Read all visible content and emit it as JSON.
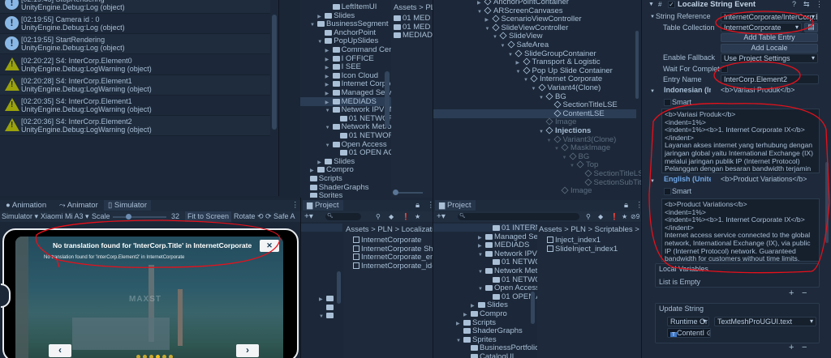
{
  "console": {
    "entries": [
      {
        "type": "info",
        "line1": "[02:19:45] StopRendering",
        "line2": "UnityEngine.Debug:Log (object)"
      },
      {
        "type": "info",
        "line1": "[02:19:55] Camera id : 0",
        "line2": "UnityEngine.Debug:Log (object)"
      },
      {
        "type": "info",
        "line1": "[02:19:55] StartRendering",
        "line2": "UnityEngine.Debug:Log (object)"
      },
      {
        "type": "warn",
        "line1": "[02:20:22] S4: InterCorp.Element0",
        "line2": "UnityEngine.Debug:LogWarning (object)"
      },
      {
        "type": "warn",
        "line1": "[02:20:28] S4: InterCorp.Element1",
        "line2": "UnityEngine.Debug:LogWarning (object)"
      },
      {
        "type": "warn",
        "line1": "[02:20:35] S4: InterCorp.Element1",
        "line2": "UnityEngine.Debug:LogWarning (object)"
      },
      {
        "type": "warn",
        "line1": "[02:20:36] S4: InterCorp.Element2",
        "line2": "UnityEngine.Debug:LogWarning (object)"
      }
    ]
  },
  "project_top": {
    "tree": [
      {
        "d": 2,
        "a": "",
        "n": "LeftItemUI"
      },
      {
        "d": 1,
        "a": "▶",
        "n": "Slides"
      },
      {
        "d": 0,
        "a": "▼",
        "n": "BusinessSegment",
        "open": true
      },
      {
        "d": 1,
        "a": "",
        "n": "AnchorPoint"
      },
      {
        "d": 1,
        "a": "▼",
        "n": "PopUpSlides",
        "open": true
      },
      {
        "d": 2,
        "a": "▶",
        "n": "Command Cente"
      },
      {
        "d": 2,
        "a": "▶",
        "n": "I OFFICE"
      },
      {
        "d": 2,
        "a": "▶",
        "n": "I SEE"
      },
      {
        "d": 2,
        "a": "▶",
        "n": "Icon Cloud"
      },
      {
        "d": 2,
        "a": "▶",
        "n": "Internet Corpora"
      },
      {
        "d": 2,
        "a": "▶",
        "n": "Managed Servic"
      },
      {
        "d": 2,
        "a": "▶",
        "n": "MEDIADS",
        "sel": true
      },
      {
        "d": 2,
        "a": "▼",
        "n": "Network IPVPN",
        "open": true
      },
      {
        "d": 3,
        "a": "",
        "n": "01 NETWORK"
      },
      {
        "d": 2,
        "a": "▼",
        "n": "Network Metron",
        "open": true
      },
      {
        "d": 3,
        "a": "",
        "n": "01 NETWORK"
      },
      {
        "d": 2,
        "a": "▼",
        "n": "Open Access",
        "open": true
      },
      {
        "d": 3,
        "a": "",
        "n": "01 OPEN ACC"
      },
      {
        "d": 1,
        "a": "▶",
        "n": "Slides"
      },
      {
        "d": 0,
        "a": "▶",
        "n": "Compro"
      },
      {
        "d": -1,
        "a": "",
        "n": "Scripts"
      },
      {
        "d": -1,
        "a": "",
        "n": "ShaderGraphs"
      },
      {
        "d": -1,
        "a": "",
        "n": "Sprites",
        "open": true
      }
    ],
    "breadcrumb": "Assets > PL",
    "assets": [
      "01 MED",
      "01 MED",
      "MEDIAD"
    ]
  },
  "hierarchy": {
    "items": [
      {
        "d": 0,
        "a": "▶",
        "n": "AnchorPointContainer"
      },
      {
        "d": 0,
        "a": "▼",
        "n": "ARScreenCanvases"
      },
      {
        "d": 1,
        "a": "▶",
        "n": "ScenarioViewController"
      },
      {
        "d": 1,
        "a": "▼",
        "n": "SlideViewController"
      },
      {
        "d": 2,
        "a": "▼",
        "n": "SlideView"
      },
      {
        "d": 3,
        "a": "▼",
        "n": "SafeArea"
      },
      {
        "d": 4,
        "a": "▼",
        "n": "SlideGroupContainer"
      },
      {
        "d": 5,
        "a": "▶",
        "n": "Transport & Logistic"
      },
      {
        "d": 5,
        "a": "▼",
        "n": "Pop Up Slide Container"
      },
      {
        "d": 6,
        "a": "▼",
        "n": "Internet Corporate"
      },
      {
        "d": 7,
        "a": "▼",
        "n": "Variant4(Clone)"
      },
      {
        "d": 8,
        "a": "▼",
        "n": "BG"
      },
      {
        "d": 9,
        "a": "",
        "n": "SectionTitleLSE"
      },
      {
        "d": 9,
        "a": "",
        "n": "ContentLSE",
        "sel": true
      },
      {
        "d": 8,
        "a": "",
        "n": "Image",
        "dim": true
      },
      {
        "d": 8,
        "a": "▼",
        "n": "Injections",
        "bold": true
      },
      {
        "d": 9,
        "a": "▼",
        "n": "Variant3(Clone)",
        "dim": true
      },
      {
        "d": 10,
        "a": "▼",
        "n": "MaskImage",
        "dim": true
      },
      {
        "d": 11,
        "a": "▼",
        "n": "BG",
        "dim": true
      },
      {
        "d": 12,
        "a": "▼",
        "n": "Top",
        "dim": true
      },
      {
        "d": 13,
        "a": "",
        "n": "SectionTitleLSE",
        "dim": true
      },
      {
        "d": 13,
        "a": "",
        "n": "SectionSubTitle",
        "dim": true
      },
      {
        "d": 10,
        "a": "",
        "n": "Image",
        "dim": true
      }
    ]
  },
  "inspector": {
    "component_title": "Localize String Event",
    "string_reference_label": "String Reference",
    "string_reference_value": "InternetCorporate/InterCorp.E",
    "table_collection_label": "Table Collection",
    "table_collection_value": "InternetCorporate",
    "add_table_entry": "Add Table Entry",
    "add_locale": "Add Locale",
    "enable_fallback_label": "Enable Fallback",
    "enable_fallback_value": "Use Project Settings",
    "wait_label": "Wait For Completi",
    "entry_name_label": "Entry Name",
    "entry_name_value": "InterCorp.Element2",
    "id_locale": "Indonesian (Inc",
    "id_preview": "<b>Variasi Produk</b>",
    "smart_label": "Smart",
    "id_text": "<b>Variasi Produk</b>\n<indent=1%>\n<indent=1%><b>1. Internet Corporate IX</b></indent>\nLayanan akses internet yang terhubung dengan jaringan global yaitu International Exchange (IX) melalui jaringan publik IP (Internet Protocol) Pelanggan dengan besaran bandwidth terjamin",
    "en_locale": "English (Unitec",
    "en_preview": "<b>Product Variations</b>",
    "en_text": "<b>Product Variations</b>\n<indent=1%>\n<indent=1%><b>1. Internet Corporate IX</b></indent>\nInternet access service connected to the global network, International Exchange (IX), via public IP (Internet Protocol) network. Guaranteed bandwidth for customers without time limits.",
    "local_variables": "Local Variables",
    "list_empty": "List is Empty",
    "update_string": "Update String",
    "runtime": "Runtime Or",
    "function": "TextMeshProUGUI.text",
    "object": "ContentI",
    "plus": "+",
    "minus": "−"
  },
  "simulator": {
    "tabs": [
      "Animation",
      "Animator",
      "Simulator"
    ],
    "mode": "Simulator",
    "device": "Xiaomi Mi A3",
    "scale_label": "Scale",
    "scale_value": "32",
    "fit": "Fit to Screen",
    "rotate": "Rotate",
    "safe": "Safe A",
    "title_msg": "No translation found for 'InterCorp.Title' in InternetCorporate",
    "body_msg": "No translation found for 'InterCorp.Element2' in InternetCorporate",
    "watermark": "MAXST",
    "close": "✕",
    "prev": "‹",
    "next": "›",
    "page_count": 6,
    "current_page": 4
  },
  "project1": {
    "tab": "Project",
    "breadcrumb": "Assets > PLN > Localizatio",
    "assets": [
      "InternetCorporate",
      "InternetCorporate Share",
      "InternetCorporate_en-U",
      "InternetCorporate_id-ID"
    ]
  },
  "project2": {
    "tab": "Project",
    "hidden_count": "9",
    "tree": [
      {
        "d": 3,
        "a": "",
        "n": "01 INTERNE"
      },
      {
        "d": 2,
        "a": "▶",
        "n": "Managed Serv"
      },
      {
        "d": 2,
        "a": "▶",
        "n": "MEDIADS"
      },
      {
        "d": 2,
        "a": "▼",
        "n": "Network IPVP",
        "open": true
      },
      {
        "d": 3,
        "a": "",
        "n": "01 NETWOF"
      },
      {
        "d": 2,
        "a": "▼",
        "n": "Network Metr",
        "open": true
      },
      {
        "d": 3,
        "a": "",
        "n": "01 NETWOF"
      },
      {
        "d": 2,
        "a": "▼",
        "n": "Open Access",
        "open": true
      },
      {
        "d": 3,
        "a": "",
        "n": "01 OPEN AC"
      },
      {
        "d": 1,
        "a": "▶",
        "n": "Slides"
      },
      {
        "d": 0,
        "a": "▶",
        "n": "Compro"
      },
      {
        "d": -1,
        "a": "▶",
        "n": "Scripts"
      },
      {
        "d": -1,
        "a": "",
        "n": "ShaderGraphs"
      },
      {
        "d": -1,
        "a": "▼",
        "n": "Sprites",
        "open": true
      },
      {
        "d": 0,
        "a": "",
        "n": "BusinessPortfolioU"
      },
      {
        "d": 0,
        "a": "",
        "n": "CatalogUI"
      }
    ],
    "breadcrumb": "Assets > PLN > Scriptables >",
    "assets": [
      "Inject_index1",
      "SlideInject_index1"
    ]
  },
  "colors": {
    "annotation": "#e8101a",
    "warning": "#9aa20c",
    "info": "#8ab8e6",
    "selected": "#2b3d55"
  }
}
